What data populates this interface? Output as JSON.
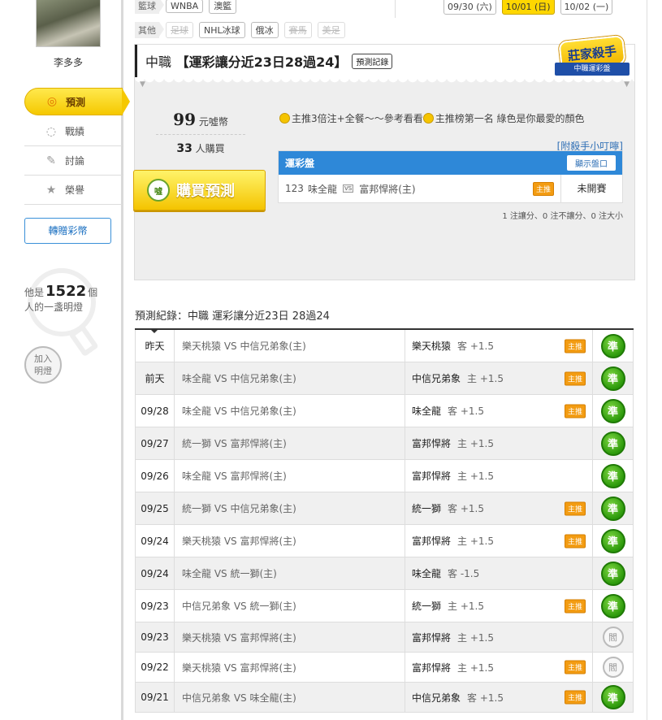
{
  "user": {
    "name": "李多多"
  },
  "menu": [
    {
      "label": "預測",
      "icon": "target-icon",
      "active": true
    },
    {
      "label": "戰績",
      "icon": "chat-icon",
      "active": false
    },
    {
      "label": "討論",
      "icon": "edit-icon",
      "active": false
    },
    {
      "label": "榮譽",
      "icon": "medal-icon",
      "active": false
    }
  ],
  "gift_button": "轉贈彩幣",
  "lamp": {
    "prefix": "他是",
    "count": "1522",
    "suffix": "個",
    "line2": "人的一盞明燈",
    "button": "加入明燈"
  },
  "filters": {
    "row1_label": "籃球",
    "row1": [
      "WNBA",
      "澳籃"
    ],
    "row2_label": "其他",
    "row2": [
      {
        "label": "足球",
        "disabled": true
      },
      {
        "label": "NHL冰球",
        "disabled": false
      },
      {
        "label": "俄冰",
        "disabled": false
      },
      {
        "label": "賽馬",
        "disabled": true
      },
      {
        "label": "美足",
        "disabled": true
      }
    ]
  },
  "dates": [
    {
      "label": "09/30 (六)",
      "active": false
    },
    {
      "label": "10/01 (日)",
      "active": true
    },
    {
      "label": "10/02 (一)",
      "active": false
    }
  ],
  "panel": {
    "league": "中職",
    "title": "【運彩讓分近23日28過24】",
    "record_button": "預測記錄",
    "badge_top": "莊家殺手",
    "badge_bottom": "中職運彩盤",
    "price": "99",
    "price_unit": "元噓幣",
    "buyers": "33",
    "buyers_unit": "人購買",
    "buy_button": "購買預測",
    "buy_icon_text": "噓",
    "tagline_1": "主推3倍注+全餐～～參考看看",
    "tagline_2": "主推榜第一名 綠色是你最愛的顏色",
    "tip_link": "[附殺手小叮嚀]",
    "bet_header": "運彩盤",
    "show_button": "顯示盤口",
    "bet": {
      "id": "123",
      "away": "味全龍",
      "vs": "VS",
      "home": "富邦悍將(主)",
      "host_tag": "主推",
      "status": "未開賽"
    },
    "summary": "1 注讓分、0 注不讓分、0 注大小"
  },
  "record": {
    "title": "預測紀錄：中職 運彩讓分近23日 28過24",
    "rows": [
      {
        "date": "昨天",
        "match": "樂天桃猿 VS 中信兄弟象(主)",
        "team": "樂天桃猿",
        "line": "客 +1.5",
        "host": true,
        "result": "準"
      },
      {
        "date": "前天",
        "match": "味全龍 VS 中信兄弟象(主)",
        "team": "中信兄弟象",
        "line": "主 +1.5",
        "host": true,
        "result": "準"
      },
      {
        "date": "09/28",
        "match": "味全龍 VS 中信兄弟象(主)",
        "team": "味全龍",
        "line": "客 +1.5",
        "host": true,
        "result": "準"
      },
      {
        "date": "09/27",
        "match": "統一獅 VS 富邦悍將(主)",
        "team": "富邦悍將",
        "line": "主 +1.5",
        "host": false,
        "result": "準"
      },
      {
        "date": "09/26",
        "match": "味全龍 VS 富邦悍將(主)",
        "team": "富邦悍將",
        "line": "主 +1.5",
        "host": false,
        "result": "準"
      },
      {
        "date": "09/25",
        "match": "統一獅 VS 中信兄弟象(主)",
        "team": "統一獅",
        "line": "客 +1.5",
        "host": true,
        "result": "準"
      },
      {
        "date": "09/24",
        "match": "樂天桃猿 VS 富邦悍將(主)",
        "team": "富邦悍將",
        "line": "主 +1.5",
        "host": true,
        "result": "準"
      },
      {
        "date": "09/24",
        "match": "味全龍 VS 統一獅(主)",
        "team": "味全龍",
        "line": "客 -1.5",
        "host": false,
        "result": "準"
      },
      {
        "date": "09/23",
        "match": "中信兄弟象 VS 統一獅(主)",
        "team": "統一獅",
        "line": "主 +1.5",
        "host": true,
        "result": "準"
      },
      {
        "date": "09/23",
        "match": "樂天桃猿 VS 富邦悍將(主)",
        "team": "富邦悍將",
        "line": "主 +1.5",
        "host": false,
        "result": "閻"
      },
      {
        "date": "09/22",
        "match": "樂天桃猿 VS 富邦悍將(主)",
        "team": "富邦悍將",
        "line": "主 +1.5",
        "host": true,
        "result": "閻"
      },
      {
        "date": "09/21",
        "match": "中信兄弟象 VS 味全龍(主)",
        "team": "中信兄弟象",
        "line": "客 +1.5",
        "host": true,
        "result": "準"
      }
    ]
  }
}
